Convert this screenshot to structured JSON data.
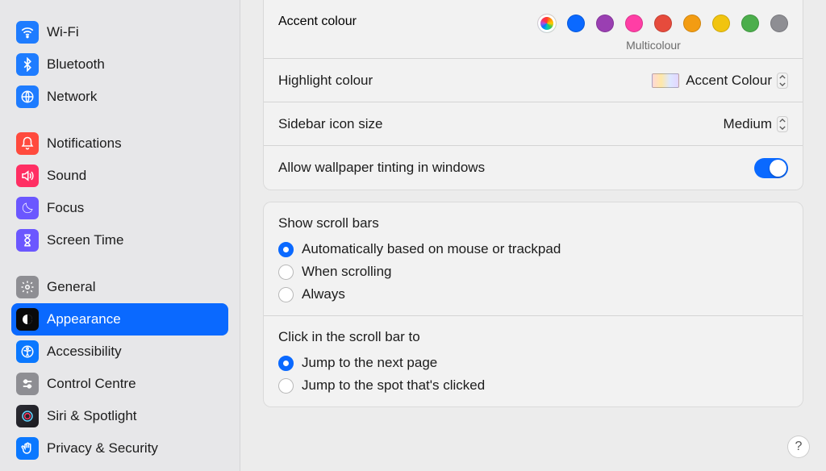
{
  "sidebar": {
    "items": [
      {
        "id": "wifi",
        "label": "Wi-Fi"
      },
      {
        "id": "bluetooth",
        "label": "Bluetooth"
      },
      {
        "id": "network",
        "label": "Network"
      },
      {
        "id": "notifications",
        "label": "Notifications"
      },
      {
        "id": "sound",
        "label": "Sound"
      },
      {
        "id": "focus",
        "label": "Focus"
      },
      {
        "id": "screentime",
        "label": "Screen Time"
      },
      {
        "id": "general",
        "label": "General"
      },
      {
        "id": "appearance",
        "label": "Appearance"
      },
      {
        "id": "accessibility",
        "label": "Accessibility"
      },
      {
        "id": "controlcentre",
        "label": "Control Centre"
      },
      {
        "id": "siri",
        "label": "Siri & Spotlight"
      },
      {
        "id": "privacy",
        "label": "Privacy & Security"
      }
    ]
  },
  "appearance": {
    "accent_label": "Accent colour",
    "accent_caption": "Multicolour",
    "accent_colors": [
      "multicolor",
      "#0a69ff",
      "#9a3fb2",
      "#ff3ea5",
      "#e64b3c",
      "#f39c12",
      "#f1c40f",
      "#4cae4c",
      "#8e8e93"
    ],
    "highlight_label": "Highlight colour",
    "highlight_value": "Accent Colour",
    "sidebar_icon_label": "Sidebar icon size",
    "sidebar_icon_value": "Medium",
    "tinting_label": "Allow wallpaper tinting in windows",
    "tinting_on": true,
    "scrollbars_title": "Show scroll bars",
    "scrollbars_options": [
      "Automatically based on mouse or trackpad",
      "When scrolling",
      "Always"
    ],
    "scrollbars_selected": 0,
    "click_title": "Click in the scroll bar to",
    "click_options": [
      "Jump to the next page",
      "Jump to the spot that's clicked"
    ],
    "click_selected": 0
  },
  "help_label": "?"
}
